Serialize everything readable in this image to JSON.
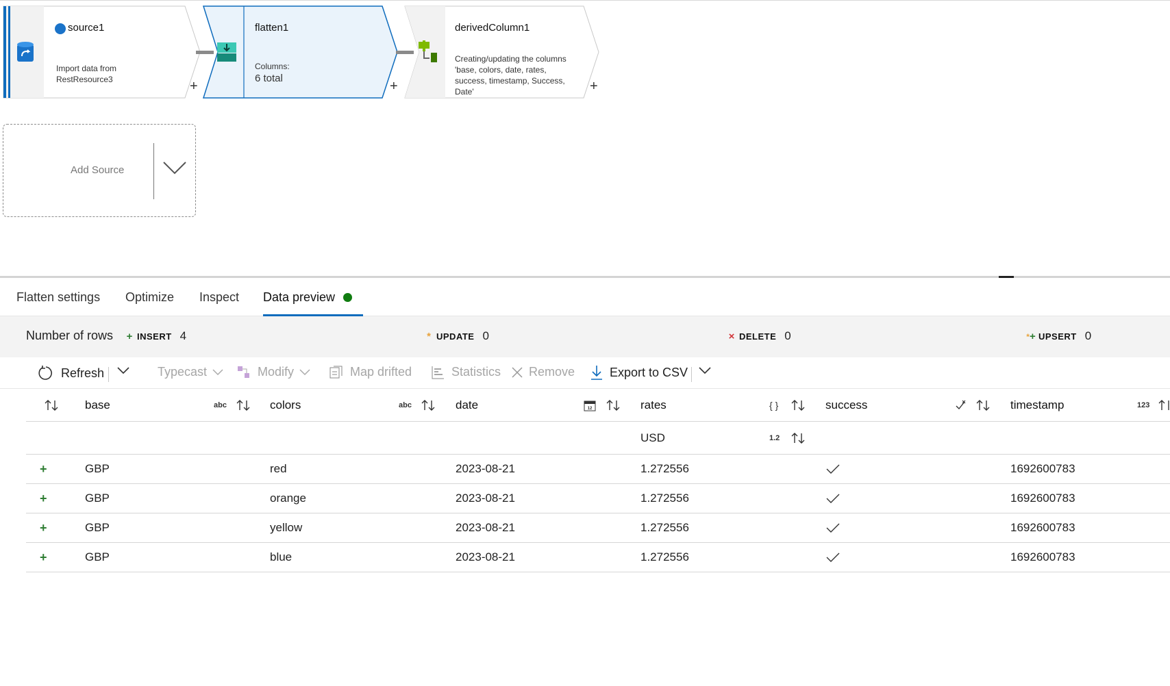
{
  "flow": {
    "nodes": [
      {
        "title": "source1",
        "desc_line1": "Import data from",
        "desc_line2": "RestResource3"
      },
      {
        "title": "flatten1",
        "desc_line1": "Columns:",
        "desc_line2": "6 total"
      },
      {
        "title": "derivedColumn1",
        "desc_line1": "Creating/updating the columns",
        "desc_line2": "'base, colors, date, rates,",
        "desc_line3": "success, timestamp, Success,",
        "desc_line4": "Date'"
      }
    ],
    "plus": "+",
    "add_source": "Add Source"
  },
  "tabs": [
    "Flatten settings",
    "Optimize",
    "Inspect",
    "Data preview"
  ],
  "row_stats": {
    "label": "Number of rows",
    "insert": {
      "name": "INSERT",
      "value": "4"
    },
    "update": {
      "name": "UPDATE",
      "value": "0"
    },
    "delete": {
      "name": "DELETE",
      "value": "0"
    },
    "upsert": {
      "name": "UPSERT",
      "value": "0"
    }
  },
  "toolbar": {
    "refresh": "Refresh",
    "typecast": "Typecast",
    "modify": "Modify",
    "map_drifted": "Map drifted",
    "statistics": "Statistics",
    "remove": "Remove",
    "export": "Export to CSV"
  },
  "grid": {
    "columns": [
      {
        "name": "base",
        "type": "abc"
      },
      {
        "name": "colors",
        "type": "abc"
      },
      {
        "name": "date",
        "type": ""
      },
      {
        "name": "rates",
        "type": "{ }"
      },
      {
        "name": "success",
        "type": ""
      },
      {
        "name": "timestamp",
        "type": "123"
      }
    ],
    "sub_header": {
      "name": "USD",
      "type": "1.2"
    },
    "rows": [
      {
        "base": "GBP",
        "colors": "red",
        "date": "2023-08-21",
        "rates": "1.272556",
        "timestamp": "1692600783"
      },
      {
        "base": "GBP",
        "colors": "orange",
        "date": "2023-08-21",
        "rates": "1.272556",
        "timestamp": "1692600783"
      },
      {
        "base": "GBP",
        "colors": "yellow",
        "date": "2023-08-21",
        "rates": "1.272556",
        "timestamp": "1692600783"
      },
      {
        "base": "GBP",
        "colors": "blue",
        "date": "2023-08-21",
        "rates": "1.272556",
        "timestamp": "1692600783"
      }
    ]
  },
  "colors": {
    "accent": "#0f6cbd",
    "insert": "#2e7d32",
    "update": "#e8a33d",
    "delete": "#d13438",
    "status_ok": "#107c10"
  }
}
